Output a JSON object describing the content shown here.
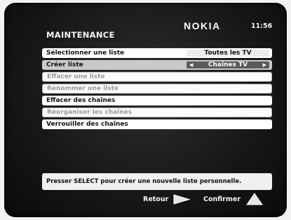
{
  "header": {
    "title": "MAINTENANCE",
    "brand": "NOKIA",
    "clock": "11:56"
  },
  "menu": [
    {
      "label": "Sélectionner une liste",
      "value": "Toutes les TV",
      "state": "enabled"
    },
    {
      "label": "Créer liste",
      "value": "Chaînes TV",
      "state": "selected"
    },
    {
      "label": "Effacer une liste",
      "state": "disabled"
    },
    {
      "label": "Renommer une liste",
      "state": "disabled"
    },
    {
      "label": "Effacer des chaînes",
      "state": "enabled"
    },
    {
      "label": "Réorganiser les chaînes",
      "state": "disabled"
    },
    {
      "label": "Verrouiller des chaînes",
      "state": "enabled"
    }
  ],
  "help_text": "Presser SELECT pour créer une nouvelle liste personnelle.",
  "footer": {
    "back_label": "Retour",
    "back_icon": "right-arrow-icon",
    "confirm_label": "Confirmer",
    "confirm_icon": "up-triangle-icon"
  }
}
